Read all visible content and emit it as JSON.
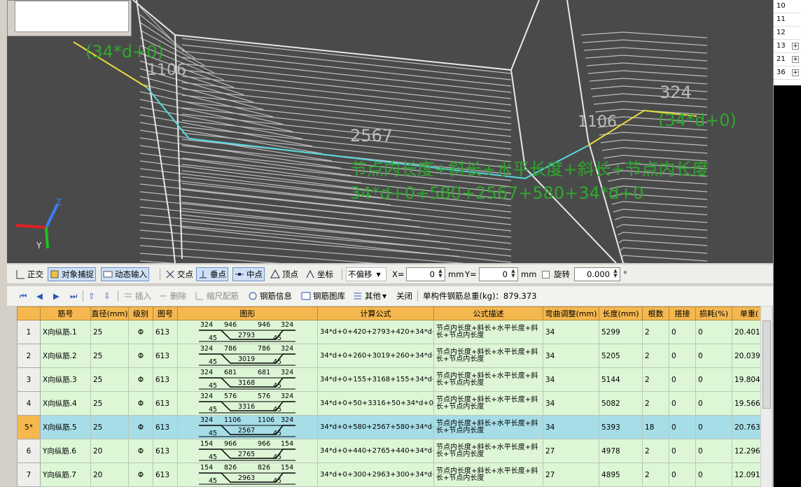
{
  "viewport": {
    "labels": {
      "formula_top_left": "(34*d+0)",
      "dim_1106_left": "1106",
      "dim_2567": "2567",
      "dim_1106_right": "1106",
      "dim_324": "324",
      "formula_right": "(34*d+0)",
      "desc_line": "节点内长度+斜长+水平长度+斜长+节点内长度",
      "formula_line": "34*d+0+580+2567+580+34*d+0"
    },
    "axes": {
      "x": "X",
      "y": "Y",
      "z": "Z"
    },
    "colors": {
      "bg": "#4a4a4a",
      "hatch": "#bdbdbd",
      "rebar_cyan": "#57d8e0",
      "rebar_yellow": "#e8df3a",
      "green_text": "#2ea82e"
    }
  },
  "right_panel": {
    "rows": [
      {
        "num": "10",
        "plus": ""
      },
      {
        "num": "11",
        "plus": ""
      },
      {
        "num": "12",
        "plus": ""
      },
      {
        "num": "13",
        "plus": "+"
      },
      {
        "num": "21",
        "plus": "+"
      },
      {
        "num": "36",
        "plus": "+"
      }
    ]
  },
  "toolbar1": {
    "ortho": "正交",
    "snap": "对象捕捉",
    "dynamic": "动态输入",
    "intersect": "交点",
    "perpendicular": "垂点",
    "midpoint": "中点",
    "vertex": "顶点",
    "coord": "坐标",
    "offset": "不偏移",
    "x_label": "X=",
    "x_value": "0",
    "x_unit": "mm",
    "y_label": "Y=",
    "y_value": "0",
    "y_unit": "mm",
    "rotate": "旋转",
    "rotate_value": "0.000",
    "deg": "°"
  },
  "toolbar2": {
    "insert": "插入",
    "delete": "删除",
    "scale": "缩尺配筋",
    "info": "钢筋信息",
    "library": "钢筋图库",
    "other": "其他",
    "close": "关闭",
    "total_label": "单构件钢筋总重(kg)：879.373"
  },
  "table": {
    "headers": [
      "",
      "筋号",
      "直径(mm)",
      "级别",
      "图号",
      "图形",
      "计算公式",
      "公式描述",
      "弯曲调整(mm)",
      "长度(mm)",
      "根数",
      "搭接",
      "损耗(%)",
      "单重("
    ],
    "rows": [
      {
        "num": "1",
        "name": "X向纵筋.1",
        "dia": "25",
        "grade": "Φ",
        "fig": "613",
        "s_l": "324",
        "s_ml": "946",
        "s_mr": "946",
        "s_r": "324",
        "s_mid": "2793",
        "s_bl": "45",
        "s_br": "45",
        "formula": "34*d+0+420+2793+420+34*d+0",
        "desc": "节点内长度+斜长+水平长度+斜长+节点内长度",
        "bend": "34",
        "length": "5299",
        "count": "2",
        "lap": "0",
        "loss": "0",
        "weight": "20.401"
      },
      {
        "num": "2",
        "name": "X向纵筋.2",
        "dia": "25",
        "grade": "Φ",
        "fig": "613",
        "s_l": "324",
        "s_ml": "786",
        "s_mr": "786",
        "s_r": "324",
        "s_mid": "3019",
        "s_bl": "45",
        "s_br": "45",
        "formula": "34*d+0+260+3019+260+34*d+0",
        "desc": "节点内长度+斜长+水平长度+斜长+节点内长度",
        "bend": "34",
        "length": "5205",
        "count": "2",
        "lap": "0",
        "loss": "0",
        "weight": "20.039"
      },
      {
        "num": "3",
        "name": "X向纵筋.3",
        "dia": "25",
        "grade": "Φ",
        "fig": "613",
        "s_l": "324",
        "s_ml": "681",
        "s_mr": "681",
        "s_r": "324",
        "s_mid": "3168",
        "s_bl": "45",
        "s_br": "45",
        "formula": "34*d+0+155+3168+155+34*d+0",
        "desc": "节点内长度+斜长+水平长度+斜长+节点内长度",
        "bend": "34",
        "length": "5144",
        "count": "2",
        "lap": "0",
        "loss": "0",
        "weight": "19.804"
      },
      {
        "num": "4",
        "name": "X向纵筋.4",
        "dia": "25",
        "grade": "Φ",
        "fig": "613",
        "s_l": "324",
        "s_ml": "576",
        "s_mr": "576",
        "s_r": "324",
        "s_mid": "3316",
        "s_bl": "45",
        "s_br": "45",
        "formula": "34*d+0+50+3316+50+34*d+0",
        "desc": "节点内长度+斜长+水平长度+斜长+节点内长度",
        "bend": "34",
        "length": "5082",
        "count": "2",
        "lap": "0",
        "loss": "0",
        "weight": "19.566"
      },
      {
        "num": "5*",
        "name": "X向纵筋.5",
        "dia": "25",
        "grade": "Φ",
        "fig": "613",
        "s_l": "324",
        "s_ml": "1106",
        "s_mr": "1106",
        "s_r": "324",
        "s_mid": "2567",
        "s_bl": "45",
        "s_br": "45",
        "formula": "34*d+0+580+2567+580+34*d+0",
        "desc": "节点内长度+斜长+水平长度+斜长+节点内长度",
        "bend": "34",
        "length": "5393",
        "count": "18",
        "lap": "0",
        "loss": "0",
        "weight": "20.763",
        "selected": true
      },
      {
        "num": "6",
        "name": "Y向纵筋.6",
        "dia": "20",
        "grade": "Φ",
        "fig": "613",
        "s_l": "154",
        "s_ml": "966",
        "s_mr": "966",
        "s_r": "154",
        "s_mid": "2765",
        "s_bl": "45",
        "s_br": "45",
        "formula": "34*d+0+440+2765+440+34*d+0",
        "desc": "节点内长度+斜长+水平长度+斜长+节点内长度",
        "bend": "27",
        "length": "4978",
        "count": "2",
        "lap": "0",
        "loss": "0",
        "weight": "12.296"
      },
      {
        "num": "7",
        "name": "Y向纵筋.7",
        "dia": "20",
        "grade": "Φ",
        "fig": "613",
        "s_l": "154",
        "s_ml": "826",
        "s_mr": "826",
        "s_r": "154",
        "s_mid": "2963",
        "s_bl": "45",
        "s_br": "45",
        "formula": "34*d+0+300+2963+300+34*d+0",
        "desc": "节点内长度+斜长+水平长度+斜长+节点内长度",
        "bend": "27",
        "length": "4895",
        "count": "2",
        "lap": "0",
        "loss": "0",
        "weight": "12.091"
      }
    ]
  }
}
